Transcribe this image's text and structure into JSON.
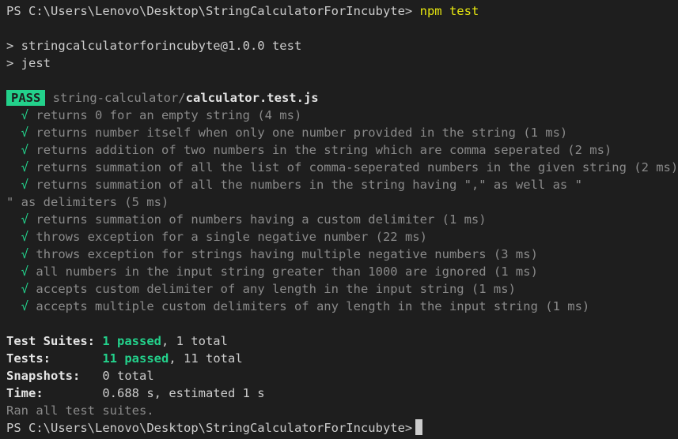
{
  "prompt_top": {
    "ps": "PS",
    "path": "C:\\Users\\Lenovo\\Desktop\\StringCalculatorForIncubyte>",
    "command": "npm test"
  },
  "npm_lines": [
    "> stringcalculatorforincubyte@1.0.0 test",
    "> jest"
  ],
  "pass_badge": "PASS",
  "test_file": {
    "dir": "string-calculator/",
    "file": "calculator.test.js"
  },
  "check_mark": "√",
  "tests": [
    "returns 0 for an empty string (4 ms)",
    "returns number itself when only one number provided in the string (1 ms)",
    "returns addition of two numbers in the string which are comma seperated (2 ms)",
    "returns summation of all the list of comma-seperated numbers in the given string (2 ms)",
    "returns summation of all the numbers in the string having \",\" as well as \"",
    "returns summation of numbers having a custom delimiter (1 ms)",
    "throws exception for a single negative number (22 ms)",
    "throws exception for strings having multiple negative numbers (3 ms)",
    "all numbers in the input string greater than 1000 are ignored (1 ms)",
    "accepts custom delimiter of any length in the input string (1 ms)",
    "accepts multiple custom delimiters of any length in the input string (1 ms)"
  ],
  "wrapped_continuation": "\" as delimiters (5 ms)",
  "summary": {
    "suites_label": "Test Suites:",
    "suites_passed": "1 passed",
    "suites_total": ", 1 total",
    "tests_label": "Tests:",
    "tests_passed": "11 passed",
    "tests_total": ", 11 total",
    "snapshots_label": "Snapshots:",
    "snapshots_value": "0 total",
    "time_label": "Time:",
    "time_value": "0.688 s, estimated 1 s",
    "ran_all": "Ran all test suites."
  },
  "prompt_bottom": {
    "ps": "PS",
    "path": "C:\\Users\\Lenovo\\Desktop\\StringCalculatorForIncubyte>"
  },
  "colors": {
    "background": "#1e1e1e",
    "pass": "#23d18b",
    "command": "#e5e510",
    "dim": "#8a8a8a"
  }
}
